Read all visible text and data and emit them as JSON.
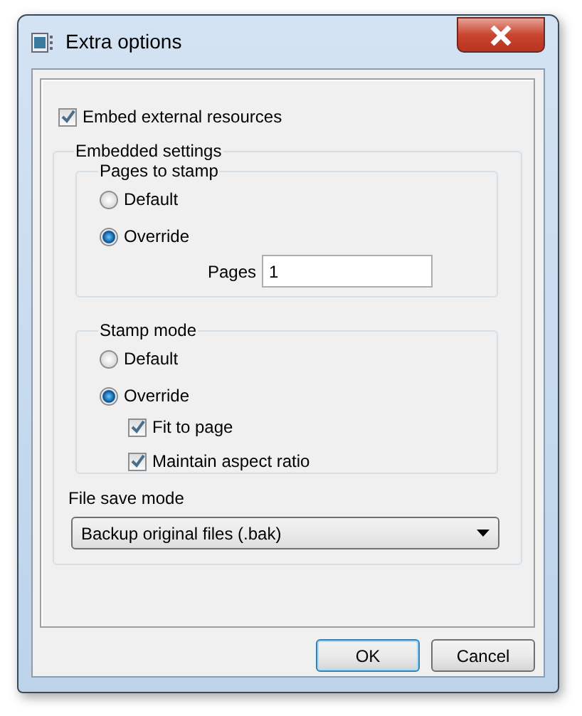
{
  "window": {
    "title": "Extra options"
  },
  "embed_external": {
    "label": "Embed external resources",
    "checked": true
  },
  "embedded_settings": {
    "title": "Embedded settings",
    "pages_to_stamp": {
      "title": "Pages to stamp",
      "options": [
        {
          "label": "Default",
          "selected": false
        },
        {
          "label": "Override",
          "selected": true
        }
      ],
      "pages": {
        "label": "Pages",
        "value": "1"
      }
    },
    "stamp_mode": {
      "title": "Stamp mode",
      "options": [
        {
          "label": "Default",
          "selected": false
        },
        {
          "label": "Override",
          "selected": true
        }
      ],
      "checkboxes": [
        {
          "label": "Fit to page",
          "checked": true
        },
        {
          "label": "Maintain aspect ratio",
          "checked": true
        }
      ]
    },
    "file_save_mode": {
      "label": "File save mode",
      "value": "Backup original files (.bak)"
    }
  },
  "buttons": [
    {
      "label": "OK",
      "default": true
    },
    {
      "label": "Cancel",
      "default": false
    }
  ]
}
